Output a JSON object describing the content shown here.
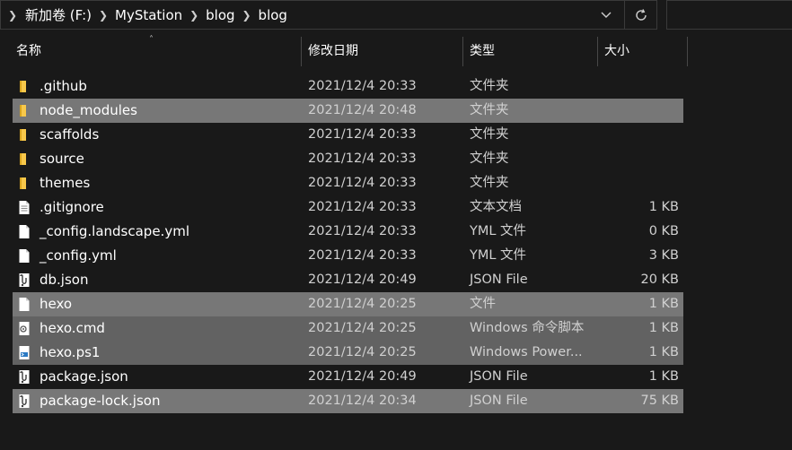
{
  "address": {
    "crumbs": [
      "新加卷 (F:)",
      "MyStation",
      "blog",
      "blog"
    ]
  },
  "columns": {
    "name": "名称",
    "date": "修改日期",
    "type": "类型",
    "size": "大小"
  },
  "icons": {
    "folder_color": "#f8c84a",
    "selection_color": "#777777"
  },
  "files": [
    {
      "name": ".github",
      "date": "2021/12/4 20:33",
      "type": "文件夹",
      "size": "",
      "icon": "folder-icon",
      "selected": false
    },
    {
      "name": "node_modules",
      "date": "2021/12/4 20:48",
      "type": "文件夹",
      "size": "",
      "icon": "folder-icon",
      "selected": true
    },
    {
      "name": "scaffolds",
      "date": "2021/12/4 20:33",
      "type": "文件夹",
      "size": "",
      "icon": "folder-icon",
      "selected": false
    },
    {
      "name": "source",
      "date": "2021/12/4 20:33",
      "type": "文件夹",
      "size": "",
      "icon": "folder-icon",
      "selected": false
    },
    {
      "name": "themes",
      "date": "2021/12/4 20:33",
      "type": "文件夹",
      "size": "",
      "icon": "folder-icon",
      "selected": false
    },
    {
      "name": ".gitignore",
      "date": "2021/12/4 20:33",
      "type": "文本文档",
      "size": "1 KB",
      "icon": "text-file-icon",
      "selected": false
    },
    {
      "name": "_config.landscape.yml",
      "date": "2021/12/4 20:33",
      "type": "YML 文件",
      "size": "0 KB",
      "icon": "file-icon",
      "selected": false
    },
    {
      "name": "_config.yml",
      "date": "2021/12/4 20:33",
      "type": "YML 文件",
      "size": "3 KB",
      "icon": "file-icon",
      "selected": false
    },
    {
      "name": "db.json",
      "date": "2021/12/4 20:49",
      "type": "JSON File",
      "size": "20 KB",
      "icon": "json-file-icon",
      "selected": false
    },
    {
      "name": "hexo",
      "date": "2021/12/4 20:25",
      "type": "文件",
      "size": "1 KB",
      "icon": "file-icon",
      "selected": true
    },
    {
      "name": "hexo.cmd",
      "date": "2021/12/4 20:25",
      "type": "Windows 命令脚本",
      "size": "1 KB",
      "icon": "cmd-file-icon",
      "selected": true
    },
    {
      "name": "hexo.ps1",
      "date": "2021/12/4 20:25",
      "type": "Windows Power...",
      "size": "1 KB",
      "icon": "powershell-file-icon",
      "selected": true
    },
    {
      "name": "package.json",
      "date": "2021/12/4 20:49",
      "type": "JSON File",
      "size": "1 KB",
      "icon": "json-file-icon",
      "selected": false
    },
    {
      "name": "package-lock.json",
      "date": "2021/12/4 20:34",
      "type": "JSON File",
      "size": "75 KB",
      "icon": "json-file-icon",
      "selected": true
    }
  ]
}
